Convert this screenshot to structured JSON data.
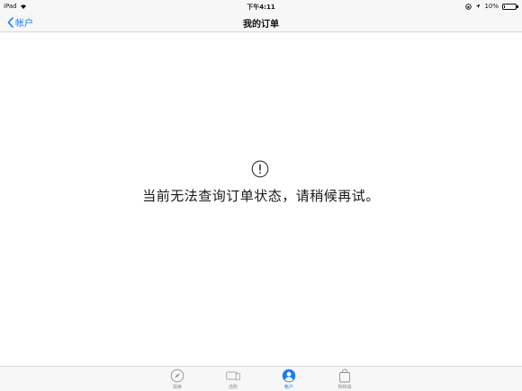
{
  "status_bar": {
    "device": "iPad",
    "time": "下午4:11",
    "battery": "10%",
    "battery_level": 0.1
  },
  "nav": {
    "back_label": "帐户",
    "title": "我的订单"
  },
  "content": {
    "message": "当前无法查询订单状态，请稍候再试。"
  },
  "tab_bar": {
    "tabs": [
      {
        "label": "探索",
        "icon": "compass-icon",
        "active": false
      },
      {
        "label": "选购",
        "icon": "devices-icon",
        "active": false
      },
      {
        "label": "帐户",
        "icon": "person-icon",
        "active": true
      },
      {
        "label": "购物袋",
        "icon": "bag-icon",
        "active": false
      }
    ]
  },
  "colors": {
    "accent": "#1a7cf5",
    "inactive": "#8e8e93"
  }
}
